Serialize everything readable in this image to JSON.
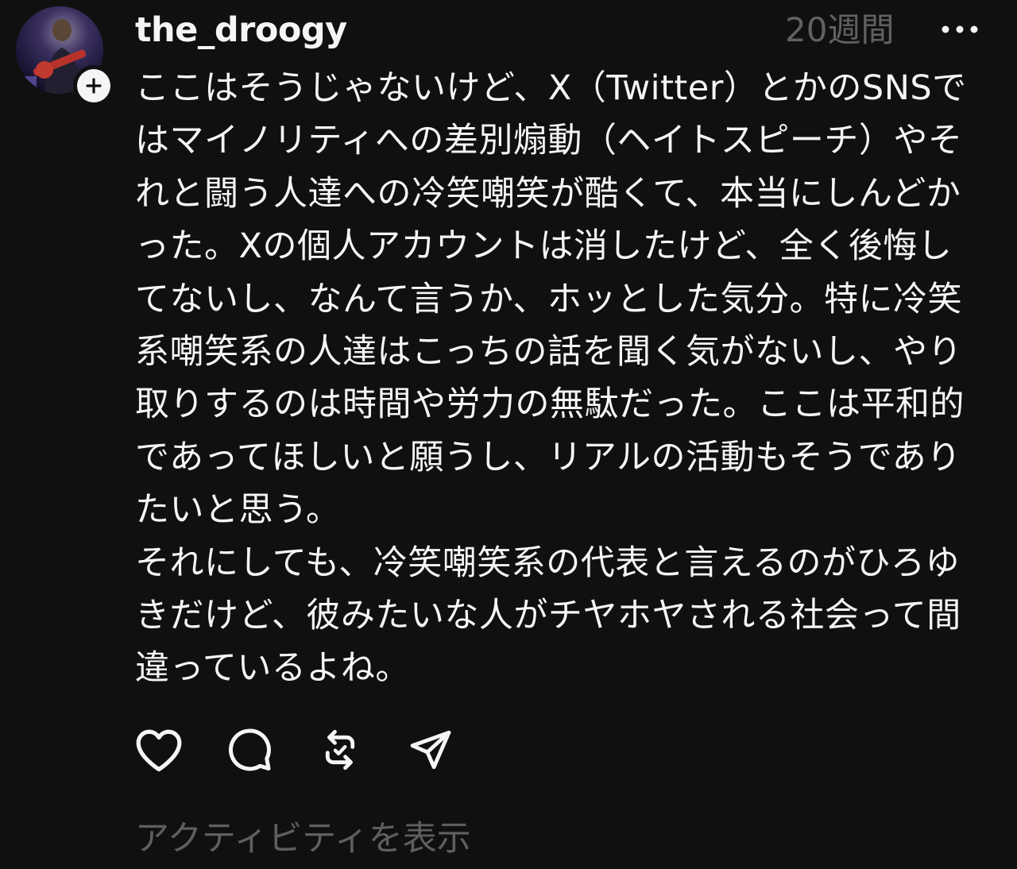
{
  "post": {
    "username": "the_droogy",
    "timestamp": "20週間",
    "avatar_icon": "profile-photo",
    "follow_icon": "plus-icon",
    "more_icon": "more-horizontal-icon",
    "body": "ここはそうじゃないけど、X（Twitter）とかのSNSではマイノリティへの差別煽動（ヘイトスピーチ）やそれと闘う人達への冷笑嘲笑が酷くて、本当にしんどかった。Xの個人アカウントは消したけど、全く後悔してないし、なんて言うか、ホッとした気分。特に冷笑系嘲笑系の人達はこっちの話を聞く気がないし、やり取りするのは時間や労力の無駄だった。ここは平和的であってほしいと願うし、リアルの活動もそうでありたいと思う。\nそれにしても、冷笑嘲笑系の代表と言えるのがひろゆきだけど、彼みたいな人がチヤホヤされる社会って間違っているよね。",
    "actions": {
      "like_icon": "heart-icon",
      "reply_icon": "comment-icon",
      "repost_icon": "repost-icon",
      "share_icon": "send-icon"
    },
    "activity_label": "アクティビティを表示"
  },
  "colors": {
    "background": "#101010",
    "primary_text": "#f3f5f7",
    "secondary_text": "#616161"
  }
}
